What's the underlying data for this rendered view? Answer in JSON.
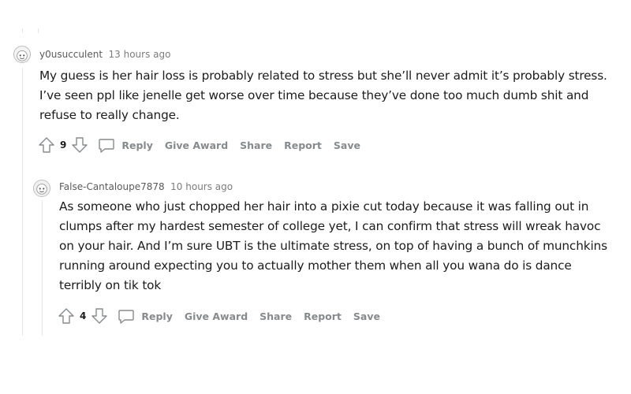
{
  "comments": [
    {
      "username": "y0usucculent",
      "time": "13 hours ago",
      "lines": [
        "My guess is her hair loss is probably related to stress but she’ll never admit it’s probably stress.",
        "I’ve seen ppl like jenelle get worse over time because they’ve done too much dumb shit and",
        "refuse to really change."
      ],
      "score": "9",
      "actions": {
        "reply": "Reply",
        "award": "Give Award",
        "share": "Share",
        "report": "Report",
        "save": "Save"
      }
    },
    {
      "username": "False-Cantaloupe7878",
      "time": "10 hours ago",
      "lines": [
        "As someone who just chopped her hair into a pixie cut today because it was falling out in",
        "clumps after my hardest semester of college yet, I can confirm that stress will wreak havoc",
        "on your hair. And I’m sure UBT is the ultimate stress, on top of having a bunch of munchkins",
        "running around expecting you to actually mother them when all you wana do is dance",
        "terribly on tik tok"
      ],
      "score": "4",
      "actions": {
        "reply": "Reply",
        "award": "Give Award",
        "share": "Share",
        "report": "Report",
        "save": "Save"
      }
    }
  ],
  "icons": {
    "upvote": "upvote-icon",
    "downvote": "downvote-icon",
    "reply": "comment-bubble-icon",
    "avatar": "snoo-avatar-icon"
  }
}
